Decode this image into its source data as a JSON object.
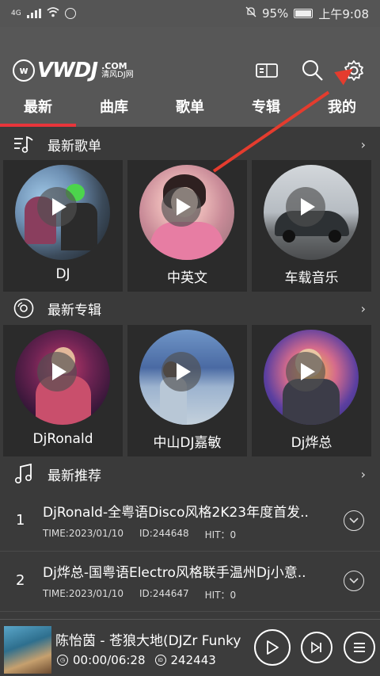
{
  "status": {
    "network": "4G",
    "battery": "95%",
    "time": "上午9:08"
  },
  "header": {
    "logo_text": "VWDJ",
    "logo_com": ".COM",
    "logo_sub": "清风DJ网",
    "icons": [
      "device-icon",
      "search-icon",
      "gear-icon"
    ]
  },
  "tabs": [
    {
      "label": "最新",
      "active": true
    },
    {
      "label": "曲库",
      "active": false
    },
    {
      "label": "歌单",
      "active": false
    },
    {
      "label": "专辑",
      "active": false
    },
    {
      "label": "我的",
      "active": false
    }
  ],
  "sections": {
    "playlists": {
      "title": "最新歌单",
      "items": [
        {
          "label": "DJ"
        },
        {
          "label": "中英文"
        },
        {
          "label": "车载音乐"
        }
      ]
    },
    "albums": {
      "title": "最新专辑",
      "items": [
        {
          "label": "DjRonald"
        },
        {
          "label": "中山DJ嘉敏"
        },
        {
          "label": "Dj烨总"
        }
      ]
    },
    "recommend": {
      "title": "最新推荐",
      "songs": [
        {
          "no": "1",
          "title": "DjRonald-全粤语Disco风格2K23年度首发..",
          "time": "TIME:2023/01/10",
          "id": "ID:244648",
          "hit": "HIT：0"
        },
        {
          "no": "2",
          "title": "Dj烨总-国粤语Electro风格联手温州Dj小意..",
          "time": "TIME:2023/01/10",
          "id": "ID:244647",
          "hit": "HIT：0"
        }
      ]
    }
  },
  "player": {
    "title": "陈怡茵 - 苍狼大地(DJZr Funky",
    "progress": "00:00/06:28",
    "id": "242443"
  },
  "colors": {
    "accent": "#e8353b",
    "annotation_arrow": "#e43c2e"
  }
}
